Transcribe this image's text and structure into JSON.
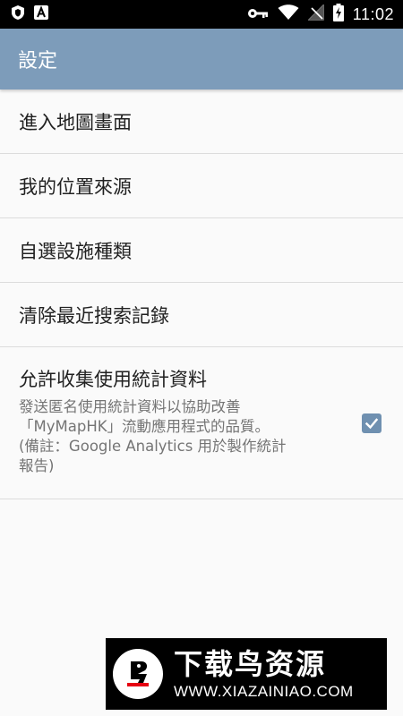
{
  "status_bar": {
    "time": "11:02",
    "left_icons": [
      "shield-icon",
      "a-letter-icon"
    ],
    "right_icons": [
      "key-icon",
      "wifi-icon",
      "no-signal-icon",
      "battery-charging-icon"
    ]
  },
  "app_bar": {
    "title": "設定",
    "color": "#7d9cba"
  },
  "preferences": {
    "enter_map": "進入地圖畫面",
    "location_source": "我的位置來源",
    "facility_types": "自選設施種類",
    "clear_history": "清除最近搜索記錄",
    "analytics": {
      "title": "允許收集使用統計資料",
      "summary": "發送匿名使用統計資料以協助改善\n「MyMapHK」流動應用程式的品質。\n(備註：Google Analytics 用於製作統計\n報告)",
      "checked": true,
      "checkbox_color": "#6f90b0"
    }
  },
  "watermark": {
    "brand": "下载鸟资源",
    "url": "WWW.XIAZAINIAO.COM"
  }
}
